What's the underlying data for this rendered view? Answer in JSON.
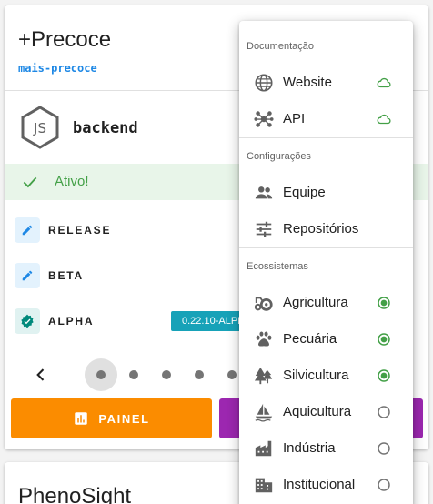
{
  "project": {
    "title": "+Precoce",
    "slug": "mais-precoce"
  },
  "service": {
    "name": "backend",
    "icon": "nodejs-icon"
  },
  "status": {
    "text": "Ativo!",
    "color": "#43a047"
  },
  "channels": [
    {
      "label": "RELEASE",
      "icon": "pencil-icon"
    },
    {
      "label": "BETA",
      "icon": "pencil-icon"
    },
    {
      "label": "ALPHA",
      "icon": "verified-badge-icon",
      "version": "0.22.10-ALPHA"
    }
  ],
  "pager": {
    "dots": 5,
    "active": 1
  },
  "buttons": {
    "painel": "PAINEL"
  },
  "next_project": {
    "title": "PhenoSight"
  },
  "menu": {
    "sections": [
      {
        "header": "Documentação",
        "items": [
          {
            "label": "Website",
            "icon": "globe-icon",
            "trail": "cloud-outline-icon"
          },
          {
            "label": "API",
            "icon": "api-icon",
            "trail": "cloud-outline-icon"
          }
        ]
      },
      {
        "header": "Configurações",
        "items": [
          {
            "label": "Equipe",
            "icon": "people-icon"
          },
          {
            "label": "Repositórios",
            "icon": "tune-icon"
          }
        ]
      },
      {
        "header": "Ecossistemas",
        "items": [
          {
            "label": "Agricultura",
            "icon": "agriculture-icon",
            "selected": true
          },
          {
            "label": "Pecuária",
            "icon": "paw-icon",
            "selected": true
          },
          {
            "label": "Silvicultura",
            "icon": "forest-icon",
            "selected": true
          },
          {
            "label": "Aquicultura",
            "icon": "sailing-icon",
            "selected": false
          },
          {
            "label": "Indústria",
            "icon": "factory-icon",
            "selected": false
          },
          {
            "label": "Institucional",
            "icon": "building-icon",
            "selected": false
          }
        ]
      }
    ]
  },
  "colors": {
    "accent_green": "#43a047",
    "orange": "#fb8c00",
    "purple": "#9c27b0",
    "teal": "#17a2b8",
    "blue": "#1e88e5"
  }
}
